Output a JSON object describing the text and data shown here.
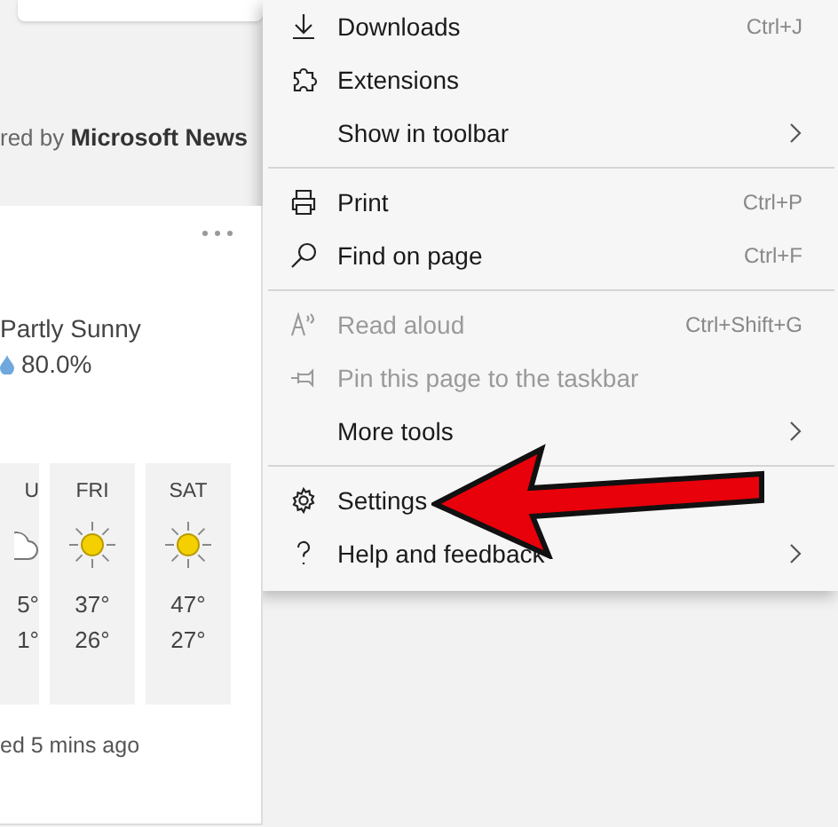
{
  "news": {
    "credit_prefix": "red by",
    "credit_source": "Microsoft News"
  },
  "weather": {
    "condition": "Partly Sunny",
    "precipitation": "80.0%",
    "updated": "ed 5 mins ago",
    "forecast": [
      {
        "day": "U",
        "kind": "cloudy",
        "high": "5°",
        "low": "1°"
      },
      {
        "day": "FRI",
        "kind": "sunny",
        "high": "37°",
        "low": "26°"
      },
      {
        "day": "SAT",
        "kind": "sunny",
        "high": "47°",
        "low": "27°"
      }
    ]
  },
  "menu": {
    "sections": [
      [
        {
          "label": "Downloads",
          "shortcut": "Ctrl+J",
          "disabled": false,
          "submenu": false
        },
        {
          "label": "Extensions",
          "disabled": false,
          "submenu": false
        },
        {
          "label": "Show in toolbar",
          "disabled": false,
          "submenu": true
        }
      ],
      [
        {
          "label": "Print",
          "shortcut": "Ctrl+P",
          "disabled": false,
          "submenu": false
        },
        {
          "label": "Find on page",
          "shortcut": "Ctrl+F",
          "disabled": false,
          "submenu": false
        }
      ],
      [
        {
          "label": "Read aloud",
          "shortcut": "Ctrl+Shift+G",
          "disabled": true,
          "submenu": false
        },
        {
          "label": "Pin this page to the taskbar",
          "disabled": true,
          "submenu": false
        },
        {
          "label": "More tools",
          "disabled": false,
          "submenu": true
        }
      ],
      [
        {
          "label": "Settings",
          "disabled": false,
          "submenu": false
        },
        {
          "label": "Help and feedback",
          "disabled": false,
          "submenu": true
        }
      ]
    ]
  }
}
